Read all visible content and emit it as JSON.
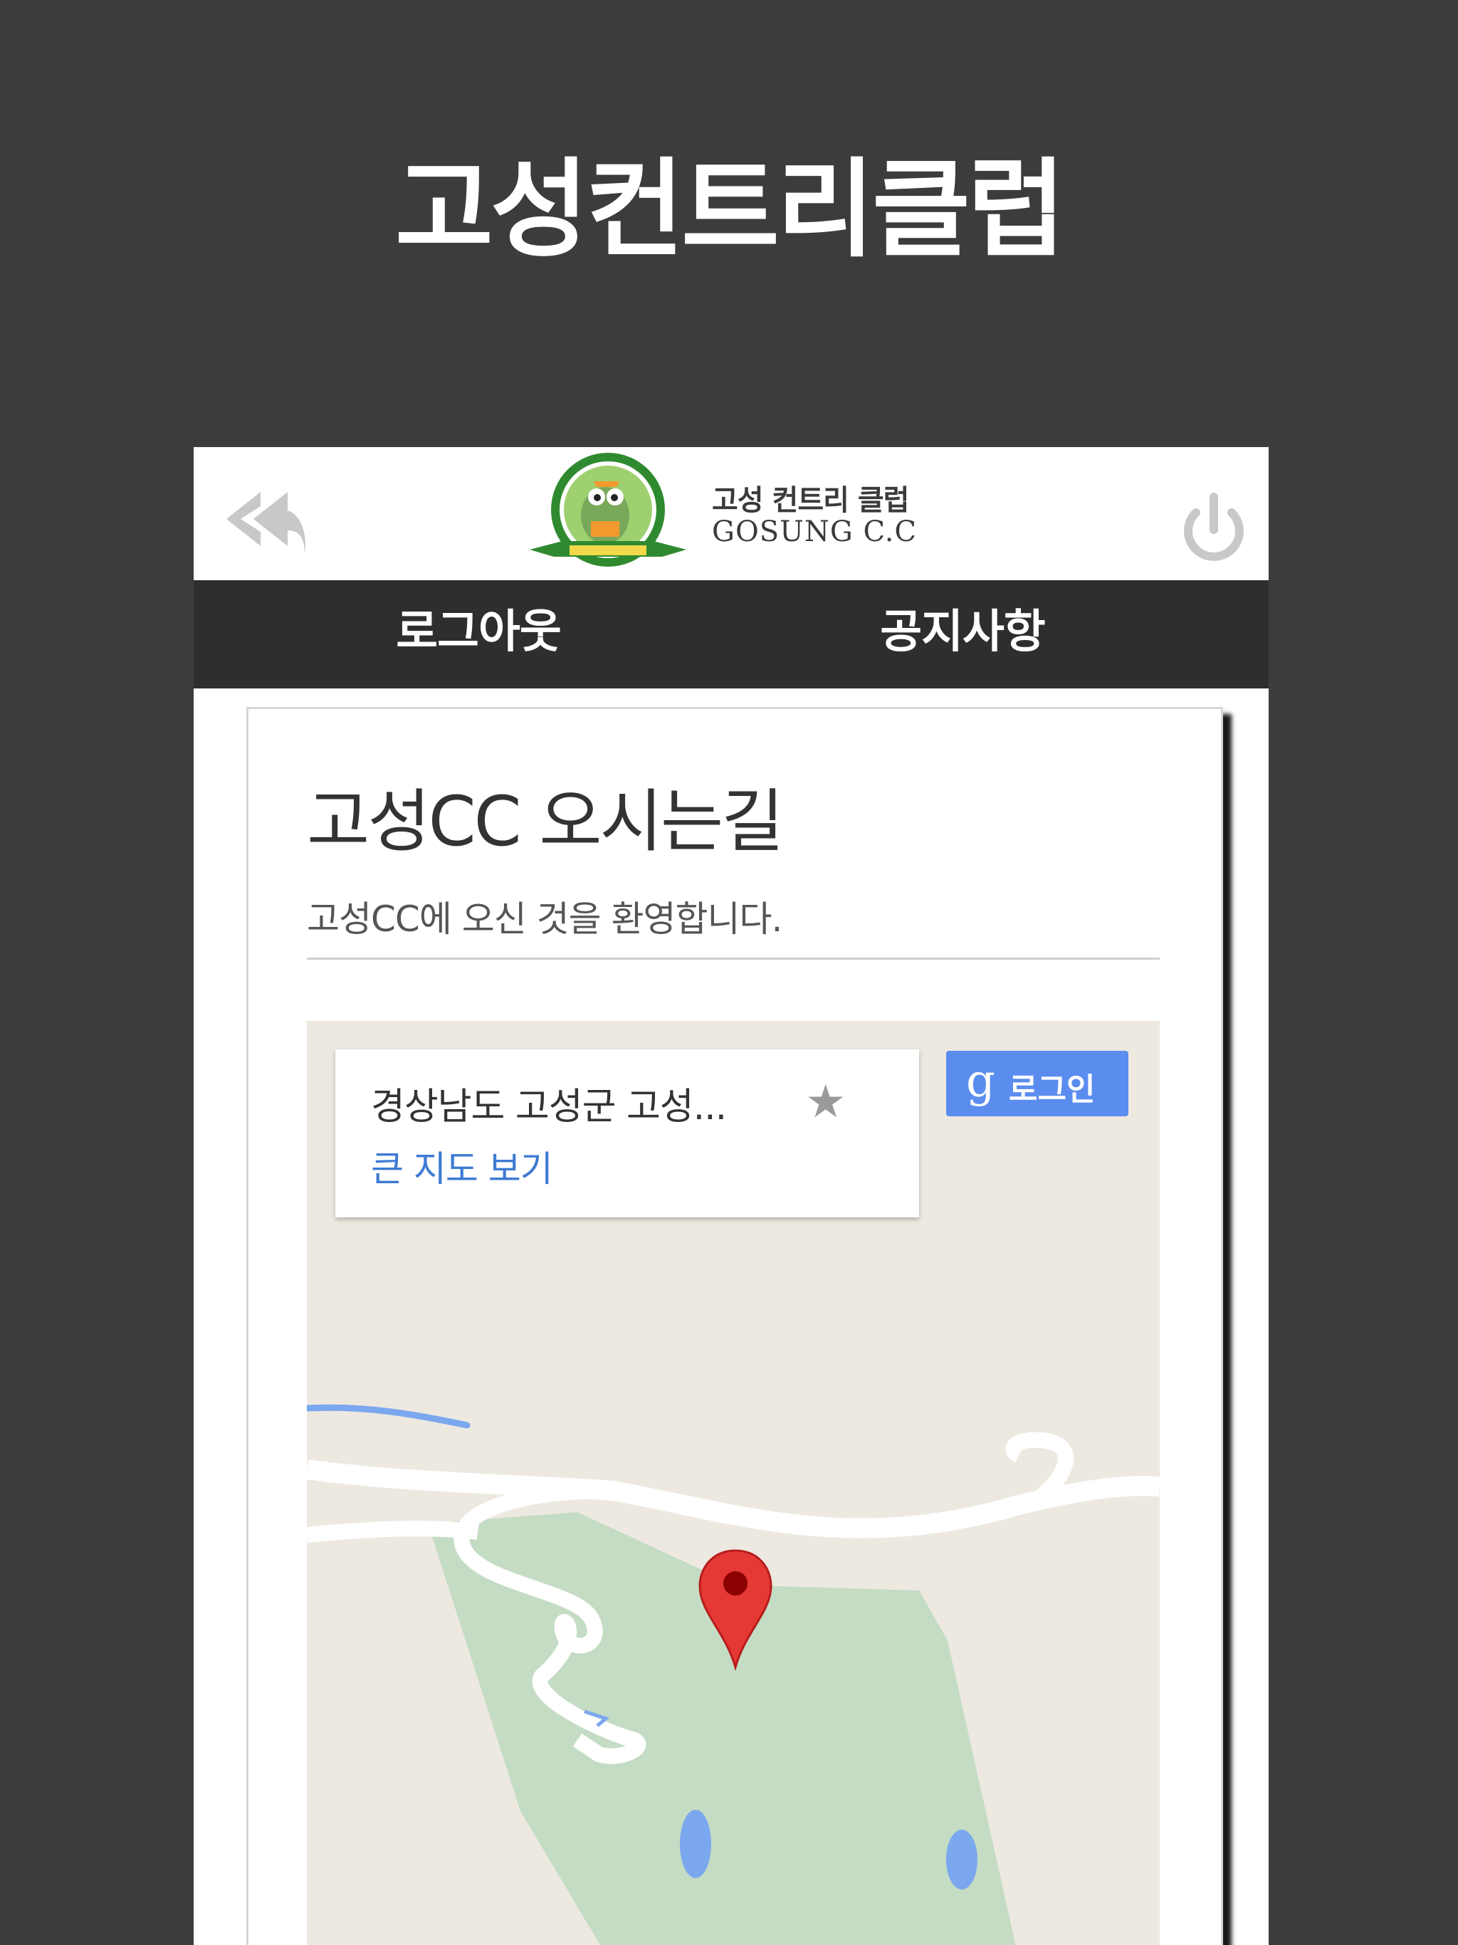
{
  "hero": {
    "title": "고성컨트리클럽"
  },
  "header": {
    "logo_kr": "고성 컨트리 클럽",
    "logo_en": "GOSUNG C.C",
    "back_icon": "reply-all-icon",
    "power_icon": "power-icon"
  },
  "nav": {
    "items": [
      {
        "label": "로그아웃"
      },
      {
        "label": "공지사항"
      }
    ]
  },
  "content": {
    "title": "고성CC 오시는길",
    "subtitle": "고성CC에 오신 것을 환영합니다."
  },
  "map": {
    "info": {
      "address": "경상남도 고성군 고성...",
      "star": "★",
      "link": "큰 지도 보기"
    },
    "login": {
      "mark": "g",
      "label": "로그인"
    },
    "colors": {
      "land": "#ede9e1",
      "park": "#c5dcc4",
      "road": "#ffffff",
      "water": "#7ba7ee",
      "pin": "#e53935",
      "button": "#5b8def"
    }
  }
}
